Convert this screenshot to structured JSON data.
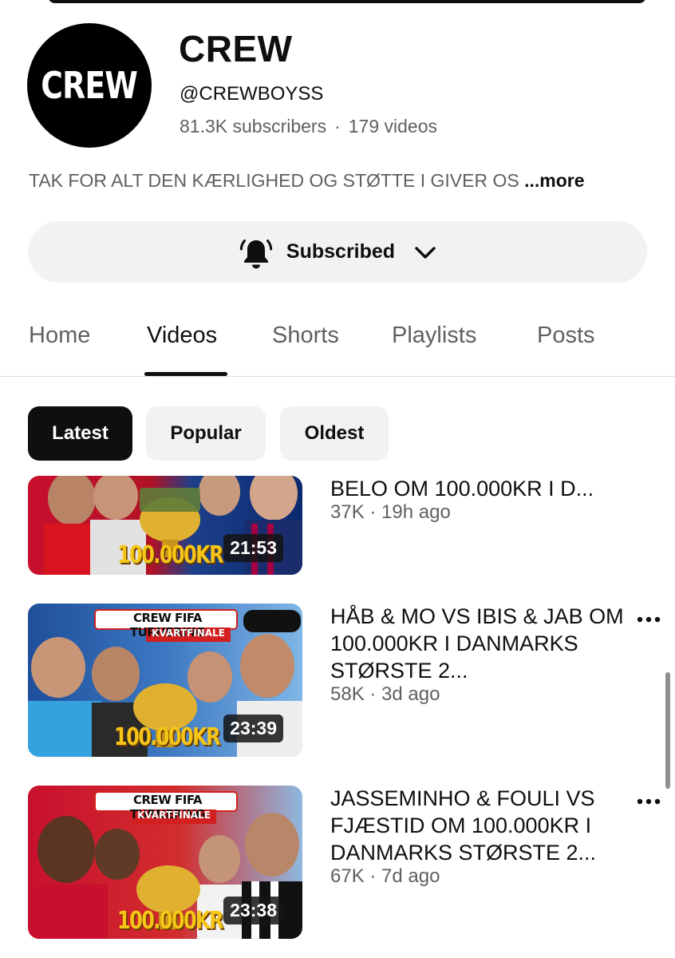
{
  "channel": {
    "avatar_text": "CREW",
    "name": "CREW",
    "handle": "@CREWBOYSS",
    "subscribers": "81.3K subscribers",
    "separator": "·",
    "videos_count": "179 videos",
    "description": "TAK FOR ALT DEN KÆRLIGHED OG STØTTE I GIVER OS",
    "more_label": "...more"
  },
  "subscribe_button": {
    "label": "Subscribed",
    "bell_icon": "bell-ringing-icon",
    "chevron_icon": "chevron-down-icon"
  },
  "tabs": [
    {
      "label": "Home",
      "active": false
    },
    {
      "label": "Videos",
      "active": true
    },
    {
      "label": "Shorts",
      "active": false
    },
    {
      "label": "Playlists",
      "active": false
    },
    {
      "label": "Posts",
      "active": false
    }
  ],
  "filters": [
    {
      "label": "Latest",
      "active": true
    },
    {
      "label": "Popular",
      "active": false
    },
    {
      "label": "Oldest",
      "active": false
    }
  ],
  "videos": [
    {
      "title": "BELO OM 100.000KR I D...",
      "meta": "37K · 19h ago",
      "duration": "21:53",
      "thumb_text": "100.000KR",
      "thumb_banner": "",
      "thumb_sub": ""
    },
    {
      "title": "HÅB & MO VS IBIS & JAB OM 100.000KR I DANMARKS STØRSTE 2...",
      "meta": "58K · 3d ago",
      "duration": "23:39",
      "thumb_text": "100.000KR",
      "thumb_banner": "CREW FIFA TURNERING",
      "thumb_sub": "KVARTFINALE"
    },
    {
      "title": "JASSEMINHO & FOULI VS FJÆSTID OM 100.000KR I DANMARKS STØRSTE 2...",
      "meta": "67K · 7d ago",
      "duration": "23:38",
      "thumb_text": "100.000KR",
      "thumb_banner": "CREW FIFA TURNERING",
      "thumb_sub": "KVARTFINALE"
    }
  ],
  "colors": {
    "text_primary": "#0f0f0f",
    "text_secondary": "#606060",
    "chip_bg": "#f2f2f2",
    "trophy_gold": "#d9a521",
    "thumb_text_gold": "#f5c518"
  }
}
